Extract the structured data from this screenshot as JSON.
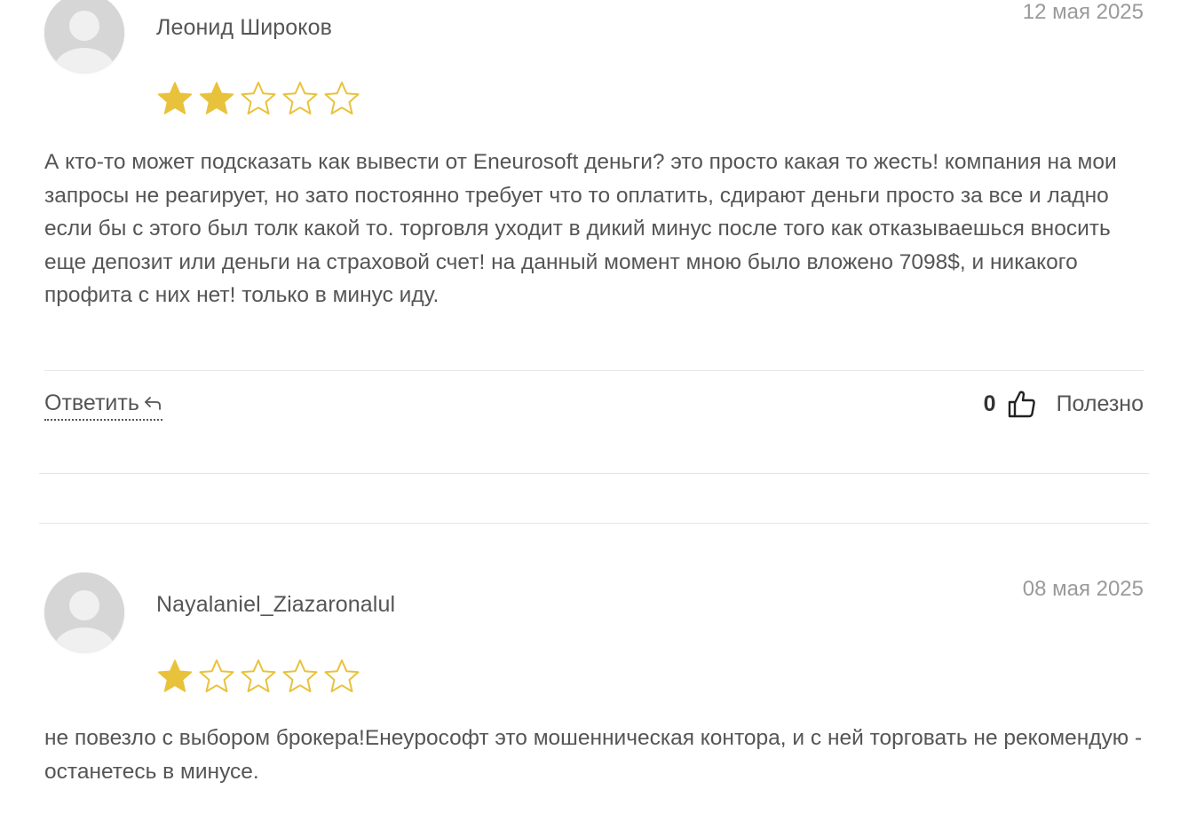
{
  "colors": {
    "star_filled": "#e9c23b",
    "star_outline": "#e9c23b",
    "avatar_bg": "#d8d8d8",
    "avatar_fg": "#f2f2f2"
  },
  "reviews": [
    {
      "author": "Леонид Широков",
      "date": "12 мая 2025",
      "rating": 2,
      "max_rating": 5,
      "text": "А кто-то может подсказать как вывести от Eneurosoft деньги? это просто какая то жесть! компания на мои запросы не реагирует, но зато постоянно требует что то оплатить, сдирают деньги просто за все и ладно если бы с этого был толк какой то. торговля уходит в дикий минус после того как отказываешься вносить еще депозит или деньги на страховой счет! на данный момент мною было вложено 7098$, и никакого профита с них нет! только в минус иду.",
      "reply_label": "Ответить",
      "reply_icon": "reply-arrow-icon",
      "useful_count": "0",
      "useful_icon": "thumbs-up-icon",
      "useful_label": "Полезно"
    },
    {
      "author": "Nayalaniel_Ziazaronalul",
      "date": "08 мая 2025",
      "rating": 1,
      "max_rating": 5,
      "text": "не повезло с выбором брокера!Енеуpософт это мошенническая контора, и с ней торговать не рекомендую - останетесь в минусе."
    }
  ]
}
